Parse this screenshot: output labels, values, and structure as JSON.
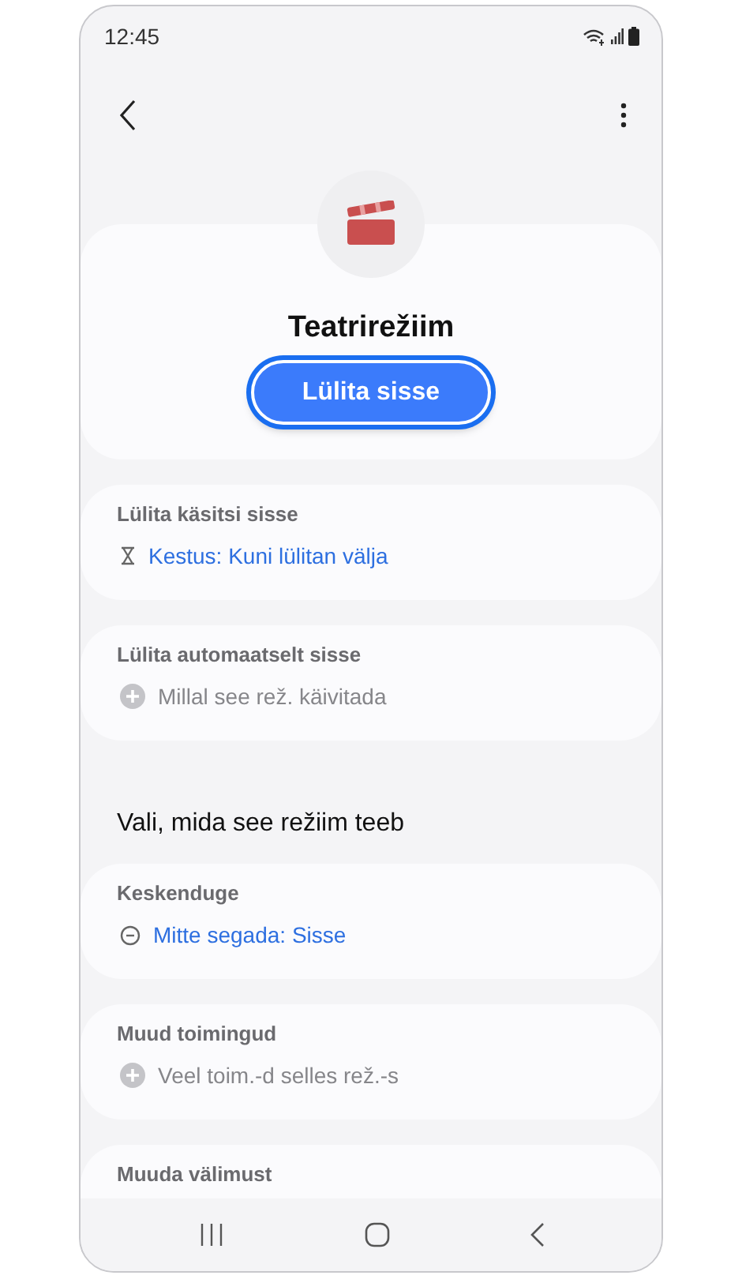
{
  "status_bar": {
    "time": "12:45"
  },
  "mode": {
    "title": "Teatrirežiim",
    "button": "Lülita sisse"
  },
  "sections": [
    {
      "kind": "card",
      "title": "Lülita käsitsi sisse",
      "item": {
        "kind": "duration",
        "text": "Kestus: Kuni lülitan välja"
      }
    },
    {
      "kind": "card",
      "title": "Lülita automaatselt sisse",
      "item": {
        "kind": "add",
        "text": "Millal see rež. käivitada"
      }
    },
    {
      "kind": "heading",
      "title": "Vali, mida see režiim teeb"
    },
    {
      "kind": "card",
      "title": "Keskenduge",
      "item": {
        "kind": "dnd",
        "text": "Mitte segada: Sisse"
      }
    },
    {
      "kind": "card",
      "title": "Muud toimingud",
      "item": {
        "kind": "add",
        "text": "Veel toim.-d selles rež.-s"
      }
    },
    {
      "kind": "card",
      "title": "Muuda välimust"
    }
  ]
}
